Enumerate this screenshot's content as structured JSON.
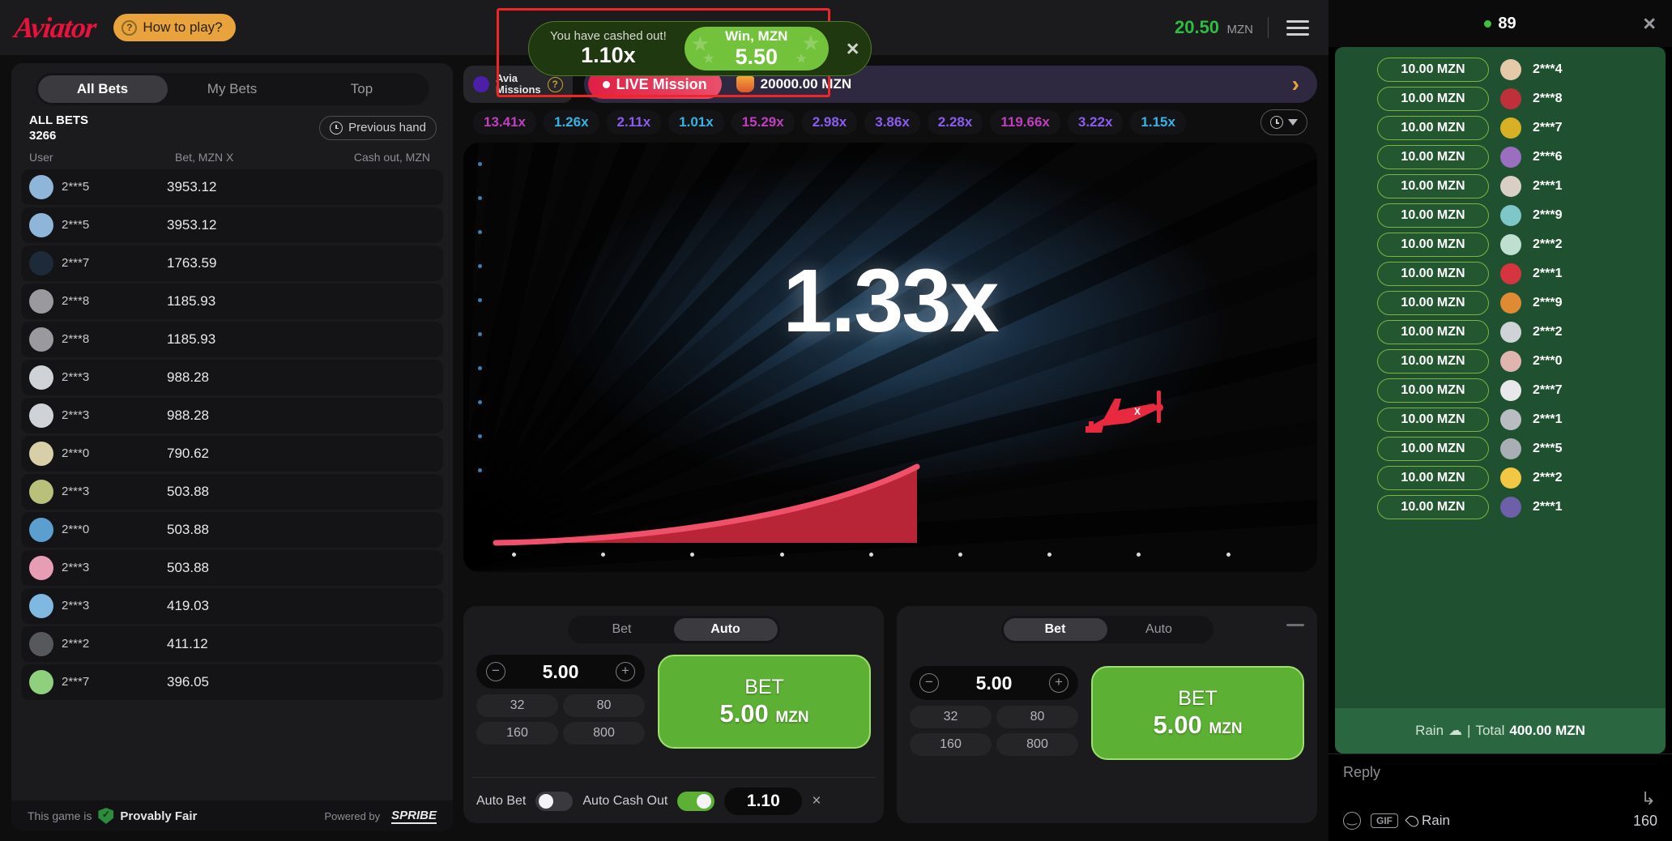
{
  "header": {
    "logo": "Aviator",
    "how_to_play": "How to play?",
    "help_icon": "question-mark-icon",
    "balance_value": "20.50",
    "balance_currency": "MZN",
    "menu_icon": "hamburger-menu-icon"
  },
  "toast": {
    "message": "You have cashed out!",
    "multiplier": "1.10x",
    "win_label": "Win, MZN",
    "win_amount": "5.50",
    "close_icon": "close-icon"
  },
  "left_panel": {
    "tabs": [
      {
        "label": "All Bets",
        "active": true
      },
      {
        "label": "My Bets",
        "active": false
      },
      {
        "label": "Top",
        "active": false
      }
    ],
    "all_bets_label": "ALL BETS",
    "all_bets_count": "3266",
    "previous_hand": "Previous hand",
    "previous_hand_icon": "history-clock-icon",
    "columns": {
      "user": "User",
      "bet": "Bet, MZN  X",
      "cashout": "Cash out, MZN"
    },
    "rows": [
      {
        "user": "2***5",
        "bet": "3953.12",
        "cashout": "",
        "avatar": "#8fb6d8"
      },
      {
        "user": "2***5",
        "bet": "3953.12",
        "cashout": "",
        "avatar": "#8fb6d8"
      },
      {
        "user": "2***7",
        "bet": "1763.59",
        "cashout": "",
        "avatar": "#1d2a3a"
      },
      {
        "user": "2***8",
        "bet": "1185.93",
        "cashout": "",
        "avatar": "#9a9a9e"
      },
      {
        "user": "2***8",
        "bet": "1185.93",
        "cashout": "",
        "avatar": "#9a9a9e"
      },
      {
        "user": "2***3",
        "bet": "988.28",
        "cashout": "",
        "avatar": "#cfd2d6"
      },
      {
        "user": "2***3",
        "bet": "988.28",
        "cashout": "",
        "avatar": "#cfd2d6"
      },
      {
        "user": "2***0",
        "bet": "790.62",
        "cashout": "",
        "avatar": "#d8cfa8"
      },
      {
        "user": "2***3",
        "bet": "503.88",
        "cashout": "",
        "avatar": "#b9c07a"
      },
      {
        "user": "2***0",
        "bet": "503.88",
        "cashout": "",
        "avatar": "#5b9ed0"
      },
      {
        "user": "2***3",
        "bet": "503.88",
        "cashout": "",
        "avatar": "#e79db3"
      },
      {
        "user": "2***3",
        "bet": "419.03",
        "cashout": "",
        "avatar": "#7fb8e0"
      },
      {
        "user": "2***2",
        "bet": "411.12",
        "cashout": "",
        "avatar": "#56585c"
      },
      {
        "user": "2***7",
        "bet": "396.05",
        "cashout": "",
        "avatar": "#8fcf7e"
      }
    ],
    "footer": {
      "this_game_is": "This game is",
      "provably_fair": "Provably Fair",
      "shield_icon": "shield-check-icon",
      "powered_by": "Powered by",
      "brand": "SPRIBE"
    }
  },
  "missions": {
    "avia_line1": "Avia",
    "avia_line2": "Missions",
    "avia_icon": "avia-missions-icon",
    "help_icon": "question-mark-icon",
    "live_label": "LIVE Mission",
    "prize_icon": "trophy-icon",
    "prize_amount": "20000.00 MZN",
    "next_icon": "chevron-right-icon"
  },
  "history": {
    "items": [
      {
        "value": "13.41x",
        "color": "#c13ec1"
      },
      {
        "value": "1.26x",
        "color": "#34b3e4"
      },
      {
        "value": "2.11x",
        "color": "#8b5cf0"
      },
      {
        "value": "1.01x",
        "color": "#34b3e4"
      },
      {
        "value": "15.29x",
        "color": "#c13ec1"
      },
      {
        "value": "2.98x",
        "color": "#8b5cf0"
      },
      {
        "value": "3.86x",
        "color": "#8b5cf0"
      },
      {
        "value": "2.28x",
        "color": "#8b5cf0"
      },
      {
        "value": "119.66x",
        "color": "#c13ec1"
      },
      {
        "value": "3.22x",
        "color": "#8b5cf0"
      },
      {
        "value": "1.15x",
        "color": "#34b3e4"
      }
    ],
    "toggle_icon": "history-dropdown-icon"
  },
  "game": {
    "current_multiplier": "1.33x",
    "plane_icon": "red-airplane-icon"
  },
  "bet_panel_left": {
    "tabs": [
      {
        "label": "Bet",
        "active": false
      },
      {
        "label": "Auto",
        "active": true
      }
    ],
    "amount": "5.00",
    "minus_icon": "minus-circle-icon",
    "plus_icon": "plus-circle-icon",
    "quick_amounts": [
      "32",
      "80",
      "160",
      "800"
    ],
    "bet_button_label": "BET",
    "bet_button_amount": "5.00",
    "bet_button_currency": "MZN",
    "auto_bet_label": "Auto Bet",
    "auto_bet_on": false,
    "auto_cashout_label": "Auto Cash Out",
    "auto_cashout_on": true,
    "auto_cashout_value": "1.10",
    "clear_icon": "close-icon"
  },
  "bet_panel_right": {
    "tabs": [
      {
        "label": "Bet",
        "active": true
      },
      {
        "label": "Auto",
        "active": false
      }
    ],
    "amount": "5.00",
    "minus_icon": "minus-circle-icon",
    "plus_icon": "plus-circle-icon",
    "quick_amounts": [
      "32",
      "80",
      "160",
      "800"
    ],
    "bet_button_label": "BET",
    "bet_button_amount": "5.00",
    "bet_button_currency": "MZN",
    "minimize_icon": "minimize-icon"
  },
  "chat": {
    "online_count": "89",
    "close_icon": "close-icon",
    "rain_rows": [
      {
        "amount": "10.00 MZN",
        "user": "2***4",
        "avatar": "#e6c9a8"
      },
      {
        "amount": "10.00 MZN",
        "user": "2***8",
        "avatar": "#c0303a"
      },
      {
        "amount": "10.00 MZN",
        "user": "2***7",
        "avatar": "#d8b024"
      },
      {
        "amount": "10.00 MZN",
        "user": "2***6",
        "avatar": "#9b6fbf"
      },
      {
        "amount": "10.00 MZN",
        "user": "2***1",
        "avatar": "#d9cfc4"
      },
      {
        "amount": "10.00 MZN",
        "user": "2***9",
        "avatar": "#7fc6c9"
      },
      {
        "amount": "10.00 MZN",
        "user": "2***2",
        "avatar": "#bfe0d0"
      },
      {
        "amount": "10.00 MZN",
        "user": "2***1",
        "avatar": "#d6343e"
      },
      {
        "amount": "10.00 MZN",
        "user": "2***9",
        "avatar": "#e08a33"
      },
      {
        "amount": "10.00 MZN",
        "user": "2***2",
        "avatar": "#cfd2d6"
      },
      {
        "amount": "10.00 MZN",
        "user": "2***0",
        "avatar": "#e0b5b0"
      },
      {
        "amount": "10.00 MZN",
        "user": "2***7",
        "avatar": "#e8e8ea"
      },
      {
        "amount": "10.00 MZN",
        "user": "2***1",
        "avatar": "#b9bcc0"
      },
      {
        "amount": "10.00 MZN",
        "user": "2***5",
        "avatar": "#a9adb4"
      },
      {
        "amount": "10.00 MZN",
        "user": "2***2",
        "avatar": "#f2c744"
      },
      {
        "amount": "10.00 MZN",
        "user": "2***1",
        "avatar": "#6d5fa8"
      }
    ],
    "footer_rain": "Rain",
    "footer_rain_icon": "rain-cloud-icon",
    "footer_sep": "|",
    "footer_total_label": "Total",
    "footer_total_value": "400.00 MZN",
    "reply_placeholder": "Reply",
    "emoji_icon": "emoji-icon",
    "gif_icon": "gif-icon",
    "rain_tool_label": "Rain",
    "rain_tool_icon": "water-drop-icon",
    "char_count": "160",
    "send_icon": "send-arrow-icon"
  }
}
